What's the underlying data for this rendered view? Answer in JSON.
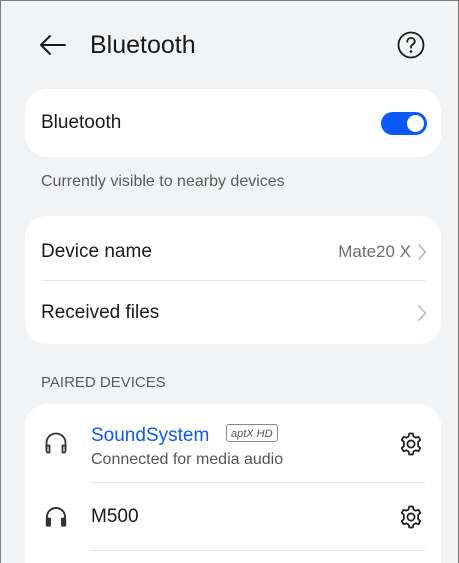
{
  "header": {
    "title": "Bluetooth",
    "back_icon": "back-arrow-icon",
    "help_icon": "help-icon"
  },
  "bluetooth_toggle": {
    "label": "Bluetooth",
    "enabled": true,
    "accent": "#0a59f7"
  },
  "visibility_hint": "Currently visible to nearby devices",
  "device_settings": {
    "device_name_label": "Device name",
    "device_name_value": "Mate20 X",
    "received_files_label": "Received files"
  },
  "paired_devices": {
    "section_title": "PAIRED DEVICES",
    "items": [
      {
        "name": "SoundSystem",
        "codec": "aptX HD",
        "status": "Connected for media audio",
        "connected": true,
        "icon": "headphones-outline-icon"
      },
      {
        "name": "M500",
        "connected": false,
        "icon": "headphones-filled-icon"
      }
    ]
  }
}
